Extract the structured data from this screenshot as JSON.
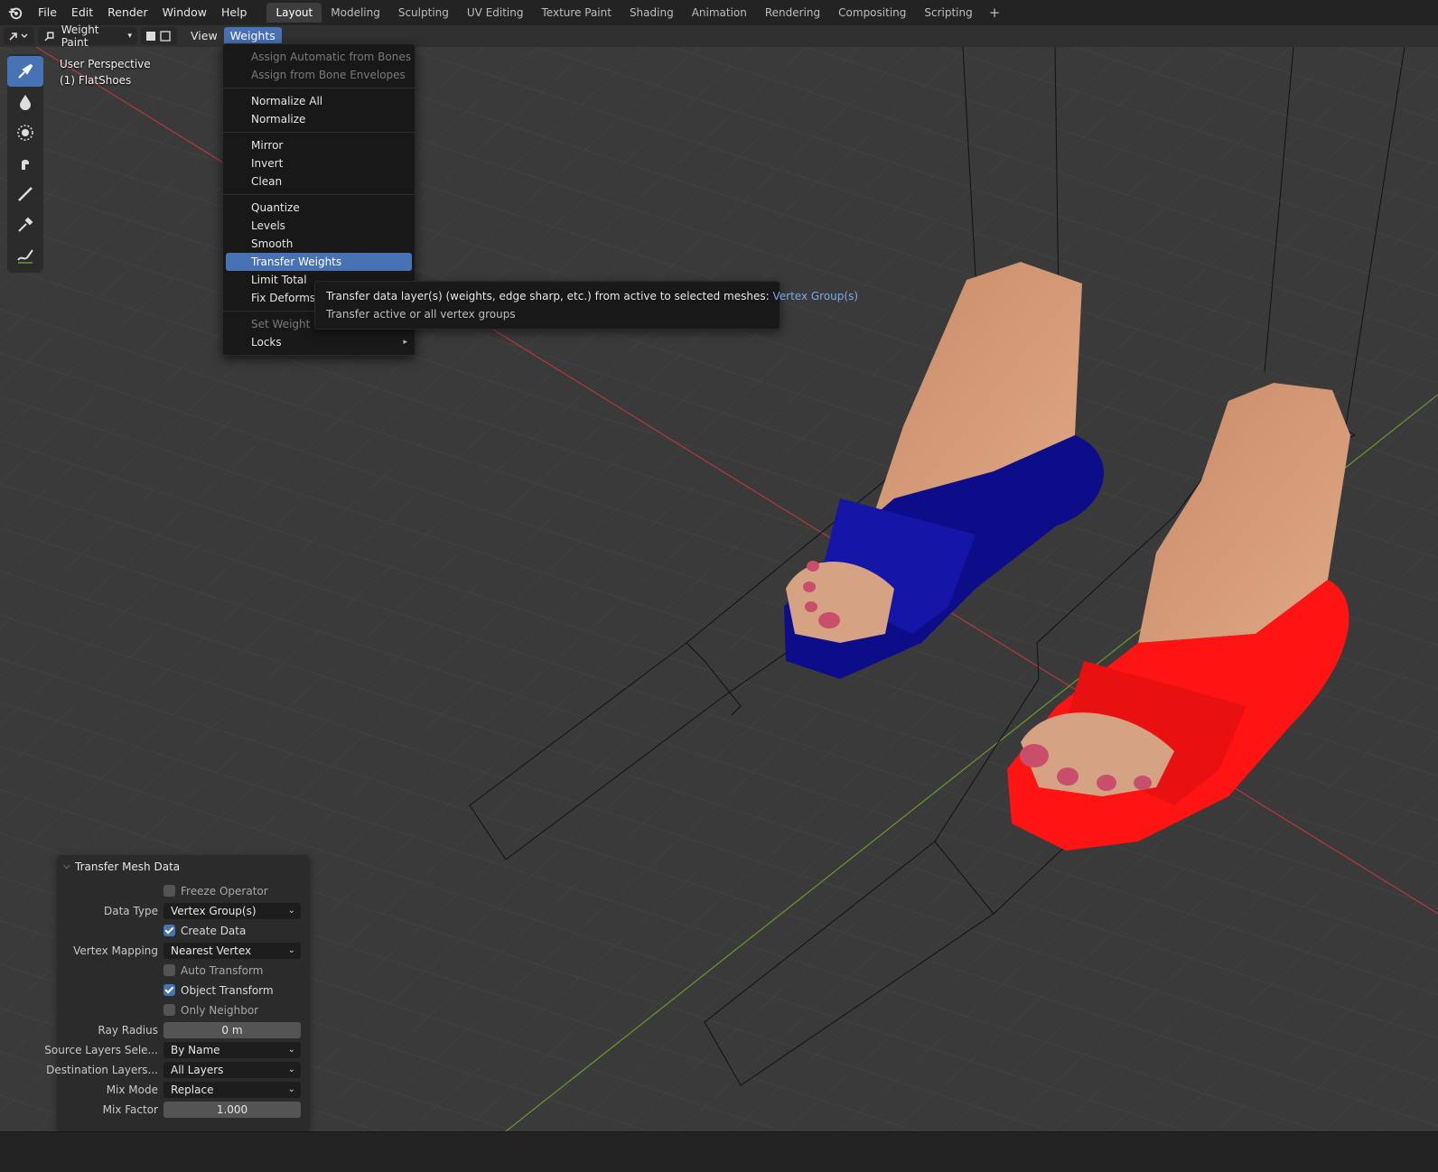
{
  "topbar": {
    "menus": [
      "File",
      "Edit",
      "Render",
      "Window",
      "Help"
    ],
    "workspaces": [
      "Layout",
      "Modeling",
      "Sculpting",
      "UV Editing",
      "Texture Paint",
      "Shading",
      "Animation",
      "Rendering",
      "Compositing",
      "Scripting"
    ],
    "active_workspace": "Layout",
    "add_tab": "+"
  },
  "header": {
    "mode": "Weight Paint",
    "menus": [
      "View",
      "Weights"
    ],
    "active_menu": "Weights"
  },
  "viewport": {
    "perspective_label": "User Perspective",
    "object_label": "(1) FlatShoes",
    "colors": {
      "blue_shoe": "#0d0d8a",
      "red_shoe": "#ff1212",
      "skin": "#d79c78",
      "grid_bg": "#3a3a3a",
      "x_axis": "#b5393d",
      "y_axis": "#6a9a2c"
    }
  },
  "tools": [
    "brush-tool-icon",
    "blur-tool-icon",
    "average-tool-icon",
    "smear-tool-icon",
    "gradient-tool-icon",
    "sample-weight-icon",
    "annotate-tool-icon"
  ],
  "weights_menu": {
    "groups": [
      [
        {
          "label": "Assign Automatic from Bones",
          "disabled": true
        },
        {
          "label": "Assign from Bone Envelopes",
          "disabled": true
        }
      ],
      [
        {
          "label": "Normalize All"
        },
        {
          "label": "Normalize"
        }
      ],
      [
        {
          "label": "Mirror"
        },
        {
          "label": "Invert"
        },
        {
          "label": "Clean"
        }
      ],
      [
        {
          "label": "Quantize"
        },
        {
          "label": "Levels"
        },
        {
          "label": "Smooth"
        },
        {
          "label": "Transfer Weights",
          "highlight": true
        },
        {
          "label": "Limit Total"
        },
        {
          "label": "Fix Deforms"
        }
      ],
      [
        {
          "label": "Set Weight",
          "disabled": true
        },
        {
          "label": "Locks",
          "submenu": true
        }
      ]
    ],
    "submenu_arrow": "▸"
  },
  "tooltip": {
    "line1": "Transfer data layer(s) (weights, edge sharp, etc.) from active to selected meshes:",
    "line1_value": "Vertex Group(s)",
    "line2": "Transfer active or all vertex groups"
  },
  "operator_panel": {
    "title": "Transfer Mesh Data",
    "freeze_operator": {
      "label": "Freeze Operator",
      "checked": false
    },
    "data_type": {
      "label": "Data Type",
      "value": "Vertex Group(s)"
    },
    "create_data": {
      "label": "Create Data",
      "checked": true
    },
    "vertex_mapping": {
      "label": "Vertex Mapping",
      "value": "Nearest Vertex"
    },
    "auto_transform": {
      "label": "Auto Transform",
      "checked": false
    },
    "object_transform": {
      "label": "Object Transform",
      "checked": true
    },
    "only_neighbor": {
      "label": "Only Neighbor Geometry",
      "checked": false
    },
    "ray_radius": {
      "label": "Ray Radius",
      "value": "0 m"
    },
    "source_layers": {
      "label": "Source Layers Sele...",
      "value": "By Name"
    },
    "dest_layers": {
      "label": "Destination Layers...",
      "value": "All Layers"
    },
    "mix_mode": {
      "label": "Mix Mode",
      "value": "Replace"
    },
    "mix_factor": {
      "label": "Mix Factor",
      "value": "1.000"
    }
  }
}
